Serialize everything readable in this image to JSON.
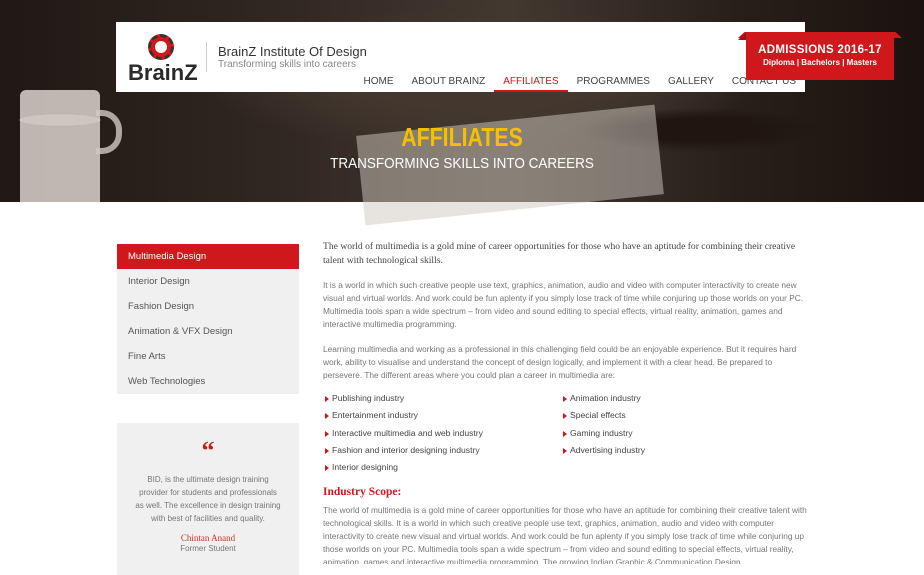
{
  "header": {
    "logo_text": "BrainZ",
    "institute_name": "BrainZ Institute Of Design",
    "tagline": "Transforming skills into careers",
    "admissions_title": "ADMISSIONS 2016-17",
    "admissions_sub": "Diploma | Bachelors | Masters",
    "nav": [
      {
        "label": "HOME"
      },
      {
        "label": "ABOUT BRAINZ"
      },
      {
        "label": "AFFILIATES"
      },
      {
        "label": "PROGRAMMES"
      },
      {
        "label": "GALLERY"
      },
      {
        "label": "CONTACT US"
      }
    ],
    "active_nav": "AFFILIATES"
  },
  "hero": {
    "title": "AFFILIATES",
    "subtitle": "TRANSFORMING SKILLS INTO CAREERS"
  },
  "sidebar": {
    "items": [
      {
        "label": "Multimedia Design"
      },
      {
        "label": "Interior Design"
      },
      {
        "label": "Fashion Design"
      },
      {
        "label": "Animation & VFX Design"
      },
      {
        "label": "Fine Arts"
      },
      {
        "label": "Web Technologies"
      }
    ],
    "active": "Multimedia Design"
  },
  "testimonial": {
    "quote_mark": "“",
    "text": "BID, is the ultimate design training provider for students and professionals as well. The excellence in design training with best of facilities and quality.",
    "name": "Chintan Anand",
    "role": "Former Student"
  },
  "main": {
    "lead": "The world of multimedia is a gold mine of career opportunities for those who have an aptitude for combining their creative talent with technological skills.",
    "para1": "It is a world in which such creative people use text, graphics, animation, audio and video with computer interactivity to create new visual and virtual worlds. And work could be fun aplenty if you simply lose track of time while conjuring up those worlds on your PC. Multimedia tools span a wide spectrum – from video and sound editing to special effects, virtual reality, animation, games and interactive multimedia programming.",
    "para2": "Learning multimedia and working as a professional in this challenging field could be an enjoyable experience. But it requires hard work, ability to visualise and understand the concept of design logically, and implement it with a clear head. Be prepared to persevere. The different areas where you could plan a career in multimedia are:",
    "bullets": [
      "Publishing industry",
      "Animation industry",
      "Entertainment industry",
      "Special effects",
      "Interactive multimedia and web industry",
      "Gaming industry",
      "Fashion and interior designing industry",
      "Advertising industry",
      "Interior designing"
    ],
    "scope_heading": "Industry Scope:",
    "scope_text": "The world of multimedia is a gold mine of career opportunities for those who have an aptitude for combining their creative talent with technological skills. It is a world in which such creative people use text, graphics, animation, audio and video with computer interactivity to create new visual and virtual worlds. And work could be fun aplenty if you simply lose track of time while conjuring up those worlds on your PC. Multimedia tools span a wide spectrum – from video and sound editing to special effects, virtual reality, animation, games and interactive multimedia programming. The growing Indian Graphic & Communication Design"
  },
  "colors": {
    "accent": "#d0181c",
    "hero_title": "#f5c000",
    "sidebar_bg": "#f0f0f0"
  }
}
